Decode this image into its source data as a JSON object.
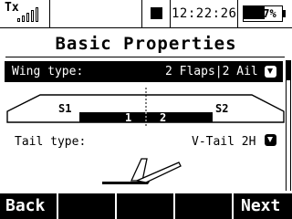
{
  "status": {
    "tx_label": "Tx",
    "signal_bars": 5,
    "time": "12:22:26",
    "battery_percent": 57,
    "battery_label": "57%"
  },
  "page": {
    "title": "Basic Properties"
  },
  "wing": {
    "label": "Wing type:",
    "value": "2 Flaps|2 Ail",
    "labels": {
      "s1": "S1",
      "c1": "1",
      "c2": "2",
      "s2": "S2"
    }
  },
  "tail": {
    "label": "Tail type:",
    "value": "V-Tail  2H"
  },
  "softkeys": {
    "back": "Back",
    "next": "Next"
  },
  "icons": {
    "signal": "signal-strength-icon",
    "stop": "stop-square-icon",
    "battery": "battery-icon",
    "dropdown": "dropdown-arrow-icon",
    "tail_graphic": "v-tail-icon"
  }
}
